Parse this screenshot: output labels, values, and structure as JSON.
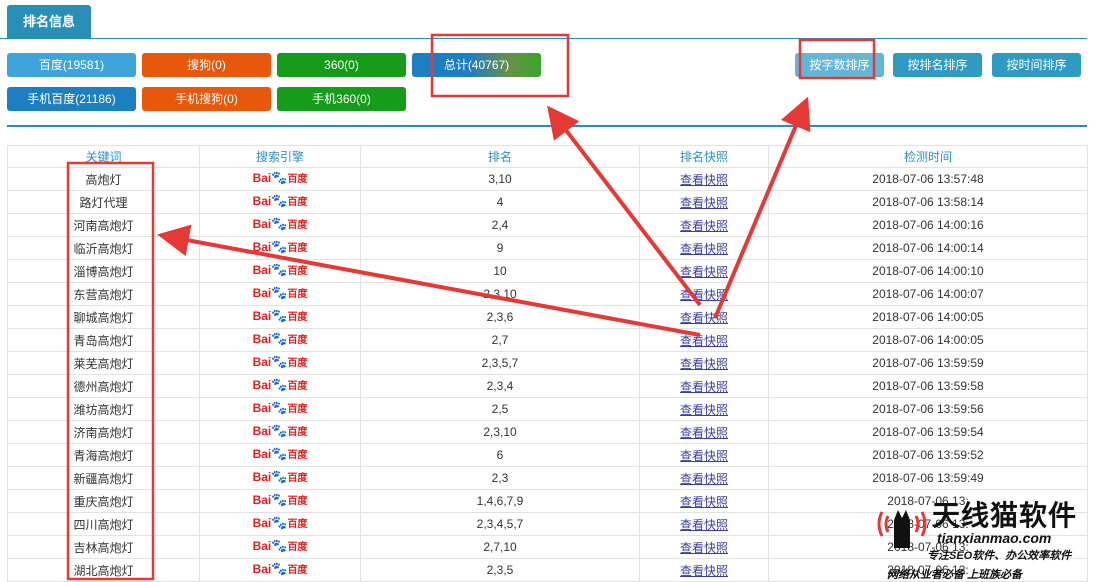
{
  "tab": {
    "label": "排名信息"
  },
  "filters": {
    "baidu": "百度(19581)",
    "sogou": "搜狗(0)",
    "s360": "360(0)",
    "total": "总计(40767)",
    "m_baidu": "手机百度(21186)",
    "m_sogou": "手机搜狗(0)",
    "m_360": "手机360(0)"
  },
  "sort": {
    "by_length": "按字数排序",
    "by_rank": "按排名排序",
    "by_time": "按时间排序"
  },
  "table": {
    "headers": [
      "关键词",
      "搜索引擎",
      "排名",
      "排名快照",
      "检测时间"
    ],
    "logo": {
      "bai": "Bai",
      "paw": "🐾",
      "du": "百度"
    },
    "rows": [
      {
        "kw": "高炮灯",
        "rank": "3,10",
        "snap": "查看快照",
        "time": "2018-07-06 13:57:48"
      },
      {
        "kw": "路灯代理",
        "rank": "4",
        "snap": "查看快照",
        "time": "2018-07-06 13:58:14"
      },
      {
        "kw": "河南高炮灯",
        "rank": "2,4",
        "snap": "查看快照",
        "time": "2018-07-06 14:00:16"
      },
      {
        "kw": "临沂高炮灯",
        "rank": "9",
        "snap": "查看快照",
        "time": "2018-07-06 14:00:14"
      },
      {
        "kw": "淄博高炮灯",
        "rank": "10",
        "snap": "查看快照",
        "time": "2018-07-06 14:00:10"
      },
      {
        "kw": "东营高炮灯",
        "rank": "2,3,10",
        "snap": "查看快照",
        "time": "2018-07-06 14:00:07"
      },
      {
        "kw": "聊城高炮灯",
        "rank": "2,3,6",
        "snap": "查看快照",
        "time": "2018-07-06 14:00:05"
      },
      {
        "kw": "青岛高炮灯",
        "rank": "2,7",
        "snap": "查看快照",
        "time": "2018-07-06 14:00:05"
      },
      {
        "kw": "莱芜高炮灯",
        "rank": "2,3,5,7",
        "snap": "查看快照",
        "time": "2018-07-06 13:59:59"
      },
      {
        "kw": "德州高炮灯",
        "rank": "2,3,4",
        "snap": "查看快照",
        "time": "2018-07-06 13:59:58"
      },
      {
        "kw": "潍坊高炮灯",
        "rank": "2,5",
        "snap": "查看快照",
        "time": "2018-07-06 13:59:56"
      },
      {
        "kw": "济南高炮灯",
        "rank": "2,3,10",
        "snap": "查看快照",
        "time": "2018-07-06 13:59:54"
      },
      {
        "kw": "青海高炮灯",
        "rank": "6",
        "snap": "查看快照",
        "time": "2018-07-06 13:59:52"
      },
      {
        "kw": "新疆高炮灯",
        "rank": "2,3",
        "snap": "查看快照",
        "time": "2018-07-06 13:59:49"
      },
      {
        "kw": "重庆高炮灯",
        "rank": "1,4,6,7,9",
        "snap": "查看快照",
        "time": "2018-07-06 13:"
      },
      {
        "kw": "四川高炮灯",
        "rank": "2,3,4,5,7",
        "snap": "查看快照",
        "time": "2018-07-06 13:"
      },
      {
        "kw": "吉林高炮灯",
        "rank": "2,7,10",
        "snap": "查看快照",
        "time": "2018-07-06 13:"
      },
      {
        "kw": "湖北高炮灯",
        "rank": "2,3,5",
        "snap": "查看快照",
        "time": "2018-07-06 13:"
      }
    ]
  },
  "watermark": {
    "title": "天线猫软件",
    "url": "tianxianmao.com",
    "slogan1": "专注SEO软件、办公效率软件",
    "slogan2": "网络从业者必备 上班族必备"
  },
  "colors": {
    "accent": "#2a8fb8",
    "annotation": "#e53935"
  }
}
